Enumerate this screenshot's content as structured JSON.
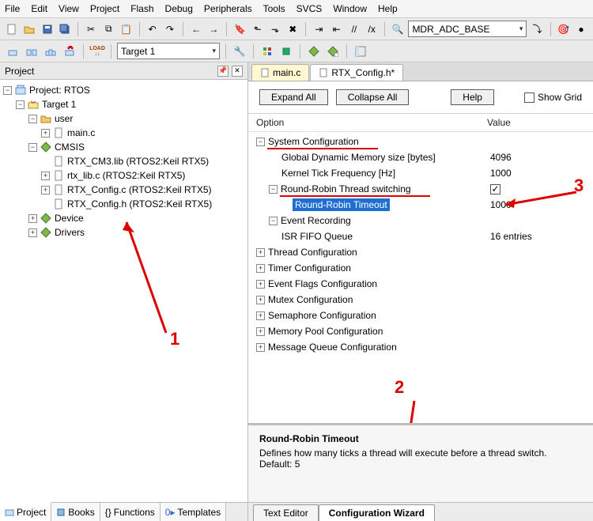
{
  "menu": {
    "items": [
      "File",
      "Edit",
      "View",
      "Project",
      "Flash",
      "Debug",
      "Peripherals",
      "Tools",
      "SVCS",
      "Window",
      "Help"
    ]
  },
  "toolbar2": {
    "target_combo": "Target 1"
  },
  "toolbar1": {
    "combo": "MDR_ADC_BASE"
  },
  "left_panel": {
    "title": "Project"
  },
  "tree": {
    "root": "Project: RTOS",
    "target": "Target 1",
    "user": "user",
    "main_c": "main.c",
    "cmsis": "CMSIS",
    "rtx_cm3": "RTX_CM3.lib (RTOS2:Keil RTX5)",
    "rtx_lib": "rtx_lib.c (RTOS2:Keil RTX5)",
    "rtx_cfg_c": "RTX_Config.c (RTOS2:Keil RTX5)",
    "rtx_cfg_h": "RTX_Config.h (RTOS2:Keil RTX5)",
    "device": "Device",
    "drivers": "Drivers"
  },
  "bottom_tabs_left": {
    "project": "Project",
    "books": "Books",
    "functions": "Functions",
    "templates": "Templates"
  },
  "file_tabs": {
    "main": "main.c",
    "rtx": "RTX_Config.h*"
  },
  "cw_toolbar": {
    "expand": "Expand All",
    "collapse": "Collapse All",
    "help": "Help",
    "showgrid": "Show Grid"
  },
  "ov": {
    "option": "Option",
    "value": "Value"
  },
  "cfg": {
    "sys": "System Configuration",
    "gmem": "Global Dynamic Memory size [bytes]",
    "gmem_v": "4096",
    "ktick": "Kernel Tick Frequency [Hz]",
    "ktick_v": "1000",
    "rr": "Round-Robin Thread switching",
    "rr_to": "Round-Robin Timeout",
    "rr_to_v": "1000",
    "ev": "Event Recording",
    "isr": "ISR FIFO Queue",
    "isr_v": "16 entries",
    "thread": "Thread Configuration",
    "timer": "Timer Configuration",
    "eflags": "Event Flags Configuration",
    "mutex": "Mutex Configuration",
    "sem": "Semaphore Configuration",
    "mem": "Memory Pool Configuration",
    "mq": "Message Queue Configuration"
  },
  "help": {
    "title": "Round-Robin Timeout",
    "line1": "Defines how many ticks a thread will execute before a thread switch.",
    "line2": "Default: 5"
  },
  "bottom_tabs_right": {
    "text": "Text Editor",
    "wizard": "Configuration Wizard"
  },
  "annotations": {
    "n1": "1",
    "n2": "2",
    "n3": "3"
  }
}
